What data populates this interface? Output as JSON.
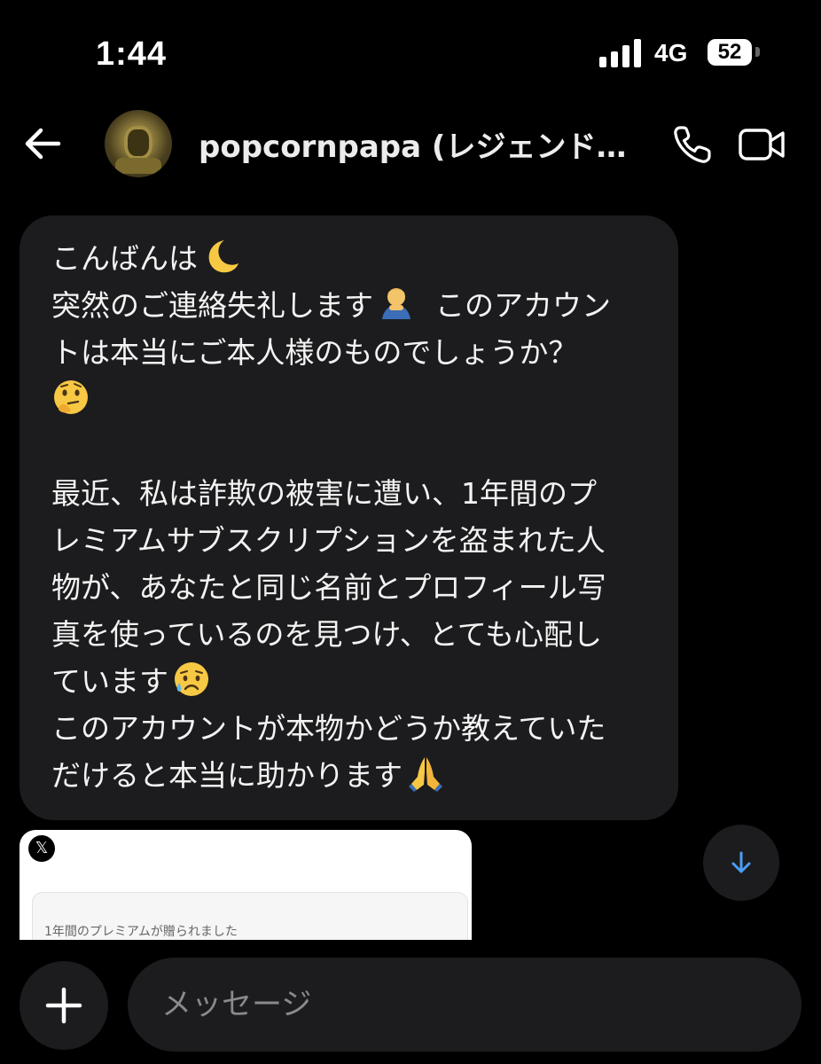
{
  "status_bar": {
    "time": "1:44",
    "network": "4G",
    "battery": "52"
  },
  "header": {
    "username": "popcornpapa (レジェンド８…"
  },
  "message": {
    "lines": [
      "こんばんは",
      "突然のご連絡失礼します",
      "トは本当にご本人様のものでしょうか？",
      "",
      "",
      "最近、私は詐欺の被害に遭い、1年間のプ",
      "レミアムサブスクリプションを盗まれた人",
      "物が、あなたと同じ名前とプロフィール写",
      "真を使っているのを見つけ、とても心配し",
      "ています",
      "このアカウントが本物かどうか教えていた",
      "だけると本当に助かります"
    ],
    "line2_suffix": "このアカウン"
  },
  "preview": {
    "badge": "𝕏",
    "text": "1年間のプレミアムが贈られました"
  },
  "composer": {
    "placeholder": "メッセージ"
  },
  "icons": {
    "back": "back-arrow-icon",
    "call": "phone-icon",
    "video": "video-camera-icon",
    "scroll": "arrow-down-icon",
    "add": "plus-icon"
  }
}
